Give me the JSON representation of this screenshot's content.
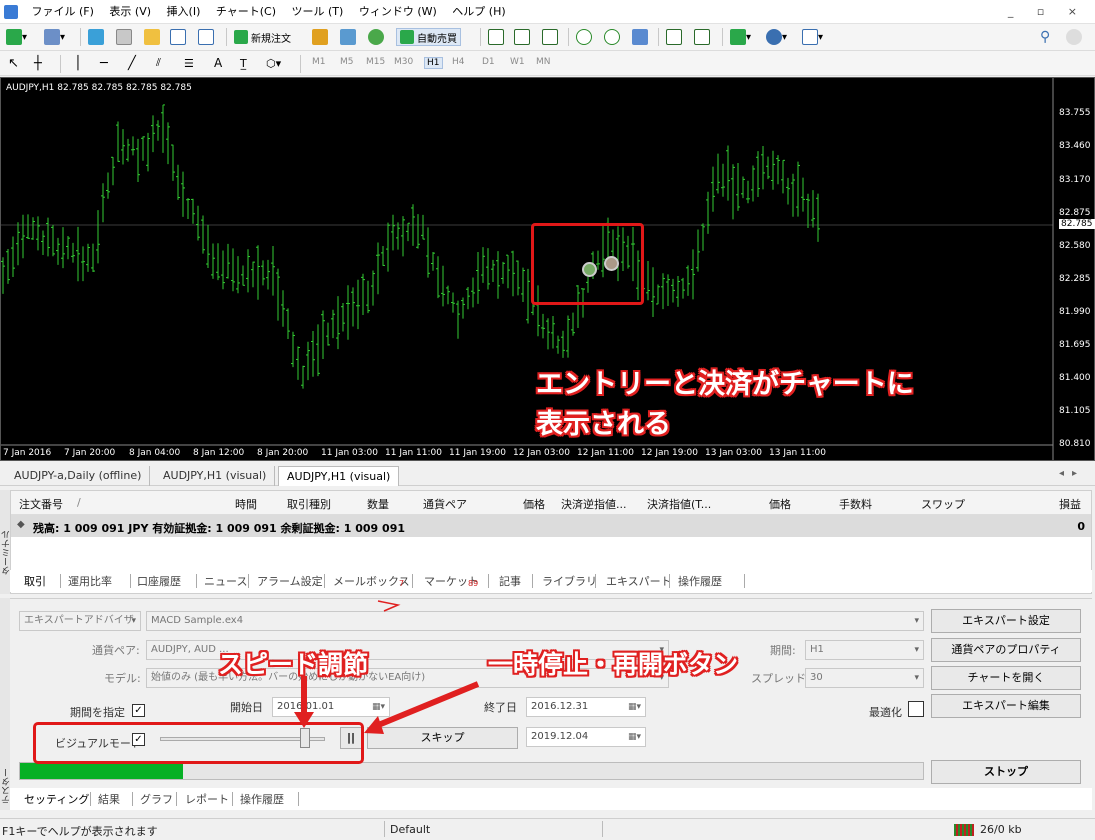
{
  "menu": {
    "items": [
      "ファイル (F)",
      "表示 (V)",
      "挿入(I)",
      "チャート(C)",
      "ツール (T)",
      "ウィンドウ (W)",
      "ヘルプ (H)"
    ],
    "window_controls": [
      "_",
      "▫",
      "×"
    ]
  },
  "toolbar": {
    "new_order": "新規注文",
    "auto_trade": "自動売買",
    "timeframes": [
      "M1",
      "M5",
      "M15",
      "M30",
      "H1",
      "H4",
      "D1",
      "W1",
      "MN"
    ],
    "text_tool": "A"
  },
  "chart": {
    "title": "AUDJPY,H1  82.785 82.785 82.785 82.785",
    "y_ticks": [
      "83.755",
      "83.460",
      "83.170",
      "82.875",
      "82.580",
      "82.285",
      "81.990",
      "81.695",
      "81.400",
      "81.105",
      "80.810"
    ],
    "current_price": "82.785",
    "x_ticks": [
      "7 Jan 2016",
      "7 Jan 20:00",
      "8 Jan 04:00",
      "8 Jan 12:00",
      "8 Jan 20:00",
      "11 Jan 03:00",
      "11 Jan 11:00",
      "11 Jan 19:00",
      "12 Jan 03:00",
      "12 Jan 11:00",
      "12 Jan 19:00",
      "13 Jan 03:00",
      "13 Jan 11:00"
    ],
    "annotation_line1": "エントリーと決済がチャートに",
    "annotation_line2": "表示される",
    "colors": {
      "background": "#000000",
      "bars": "#33cc33",
      "annotation": "#e02020"
    }
  },
  "chart_tabs": [
    "AUDJPY-a,Daily (offline)",
    "AUDJPY,H1 (visual)",
    "AUDJPY,H1 (visual)"
  ],
  "terminal": {
    "side_label": "ターミナル",
    "headers": [
      "注文番号",
      "/",
      "時間",
      "取引種別",
      "数量",
      "通貨ペア",
      "価格",
      "決済逆指値...",
      "決済指値(T...",
      "価格",
      "手数料",
      "スワップ",
      "損益"
    ],
    "balance_row": "残高: 1 009 091 JPY  有効証拠金: 1 009 091  余剰証拠金: 1 009 091",
    "balance_value": "0",
    "tabs": [
      "取引",
      "運用比率",
      "口座履歴",
      "ニュース",
      "アラーム設定",
      "メールボックス",
      "マーケット",
      "記事",
      "ライブラリ",
      "エキスパート",
      "操作履歴"
    ],
    "mailbox_badge": "7",
    "market_badge": "89"
  },
  "tester": {
    "side_label": "テスター",
    "type_select": "エキスパートアドバイザ",
    "ea_select": "MACD Sample.ex4",
    "pair_label": "通貨ペア:",
    "pair_value": "AUDJPY, AUD ...",
    "model_label": "モデル:",
    "model_value": "始値のみ (最も早い方法。バーの始めにしか動かないEA向け)",
    "use_date_label": "期間を指定",
    "use_date_checked": "✓",
    "start_label": "開始日",
    "start_value": "2016.01.01",
    "end_label": "終了日",
    "end_value": "2016.12.31",
    "visual_label": "ビジュアルモード",
    "visual_checked": "✓",
    "speed_slider": 0.9,
    "pause_label": "||",
    "skip_label": "スキップ",
    "skip_date": "2019.12.04",
    "period_label": "期間:",
    "period_value": "H1",
    "spread_label": "スプレッド:",
    "spread_value": "30",
    "optimize_label": "最適化",
    "buttons": [
      "エキスパート設定",
      "通貨ペアのプロパティ",
      "チャートを開く",
      "エキスパート編集"
    ],
    "stop_label": "ストップ",
    "progress": 0.18,
    "tabs": [
      "セッティング",
      "結果",
      "グラフ",
      "レポート",
      "操作履歴"
    ]
  },
  "annotations": {
    "speed": "スピード調節",
    "pause": "一時停止・再開ボタン"
  },
  "status": {
    "help": "F1キーでヘルプが表示されます",
    "profile": "Default",
    "traffic": "26/0 kb"
  }
}
